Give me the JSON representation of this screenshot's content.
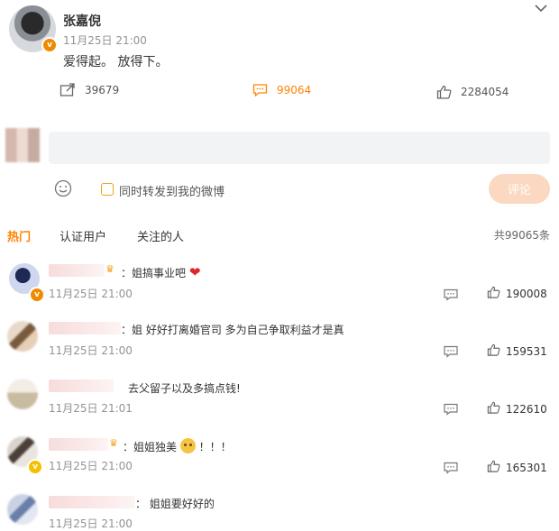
{
  "post": {
    "author": "张嘉倪",
    "time": "11月25日 21:00",
    "text": "爱得起。 放得下。",
    "repost_count": "39679",
    "comment_count": "99064",
    "like_count": "2284054"
  },
  "composer": {
    "placeholder": "",
    "repost_label": "同时转发到我的微博",
    "submit_label": "评论"
  },
  "tabs": [
    "热门",
    "认证用户",
    "关注的人"
  ],
  "total_comments": "共99065条",
  "comments": [
    {
      "text": "：姐搞事业吧",
      "time": "11月25日 21:00",
      "likes": "190008"
    },
    {
      "text": "：姐 好好打离婚官司 多为自己争取利益才是真",
      "time": "11月25日 21:00",
      "likes": "159531"
    },
    {
      "text": "去父留子以及多搞点钱!",
      "time": "11月25日 21:01",
      "likes": "122610"
    },
    {
      "text": "：姐姐独美",
      "suffix": "！！！",
      "time": "11月25日 21:00",
      "likes": "165301"
    },
    {
      "text": "：  姐姐要好好的",
      "time": "11月25日 21:00",
      "likes": ""
    }
  ],
  "colors": {
    "accent": "#ff8200",
    "verified": "#f08a00",
    "meta": "#939393"
  }
}
